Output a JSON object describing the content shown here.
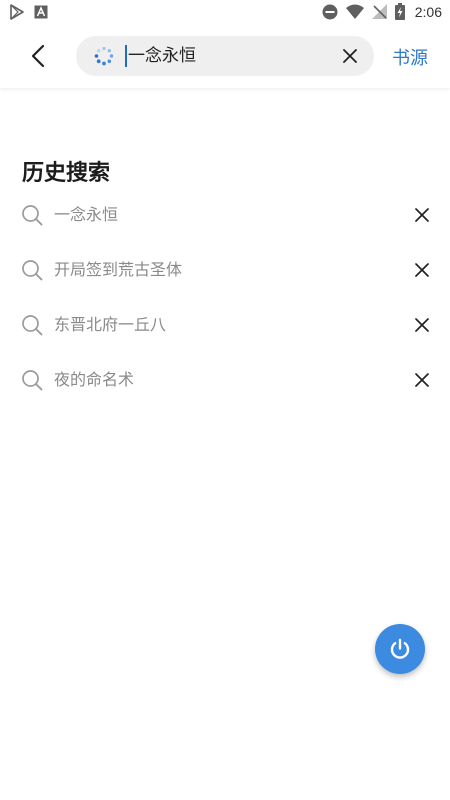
{
  "status_bar": {
    "time": "2:06",
    "icons": [
      "play-store-icon",
      "text-a-icon",
      "do-not-disturb-icon",
      "wifi-icon",
      "no-signal-icon",
      "battery-charging-icon"
    ]
  },
  "top_bar": {
    "search": {
      "value": "一念永恒",
      "placeholder": ""
    },
    "source_label": "书源",
    "accent_color": "#2f78c8"
  },
  "history": {
    "title": "历史搜索",
    "items": [
      {
        "label": "一念永恒"
      },
      {
        "label": "开局签到荒古圣体"
      },
      {
        "label": "东晋北府一丘八"
      },
      {
        "label": "夜的命名术"
      }
    ]
  },
  "fab": {
    "icon": "power-icon",
    "color": "#3d8be0"
  }
}
